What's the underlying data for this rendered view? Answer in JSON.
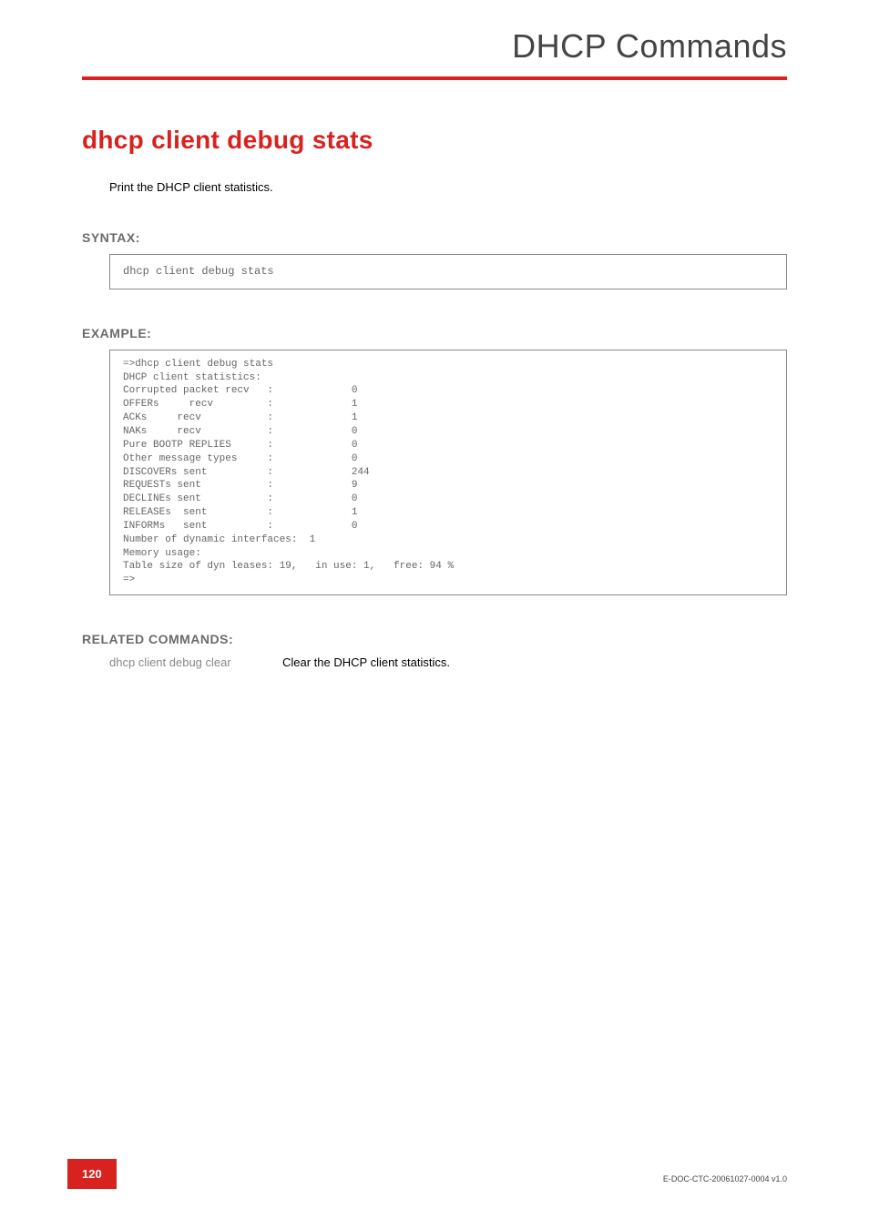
{
  "header": {
    "title": "DHCP Commands"
  },
  "command": {
    "title": "dhcp client debug stats",
    "description": "Print the DHCP client statistics."
  },
  "syntax": {
    "label": "SYNTAX:",
    "code": "dhcp client debug stats"
  },
  "example": {
    "label": "EXAMPLE:",
    "code": "=>dhcp client debug stats\nDHCP client statistics:\nCorrupted packet recv   :             0\nOFFERs     recv         :             1\nACKs     recv           :             1\nNAKs     recv           :             0\nPure BOOTP REPLIES      :             0\nOther message types     :             0\nDISCOVERs sent          :             244\nREQUESTs sent           :             9\nDECLINEs sent           :             0\nRELEASEs  sent          :             1\nINFORMs   sent          :             0\nNumber of dynamic interfaces:  1\nMemory usage:\nTable size of dyn leases: 19,   in use: 1,   free: 94 %\n=>"
  },
  "related": {
    "label": "RELATED COMMANDS:",
    "rows": [
      {
        "cmd": "dhcp client debug clear",
        "desc": "Clear the DHCP client statistics."
      }
    ]
  },
  "footer": {
    "page": "120",
    "docid": "E-DOC-CTC-20061027-0004 v1.0"
  }
}
